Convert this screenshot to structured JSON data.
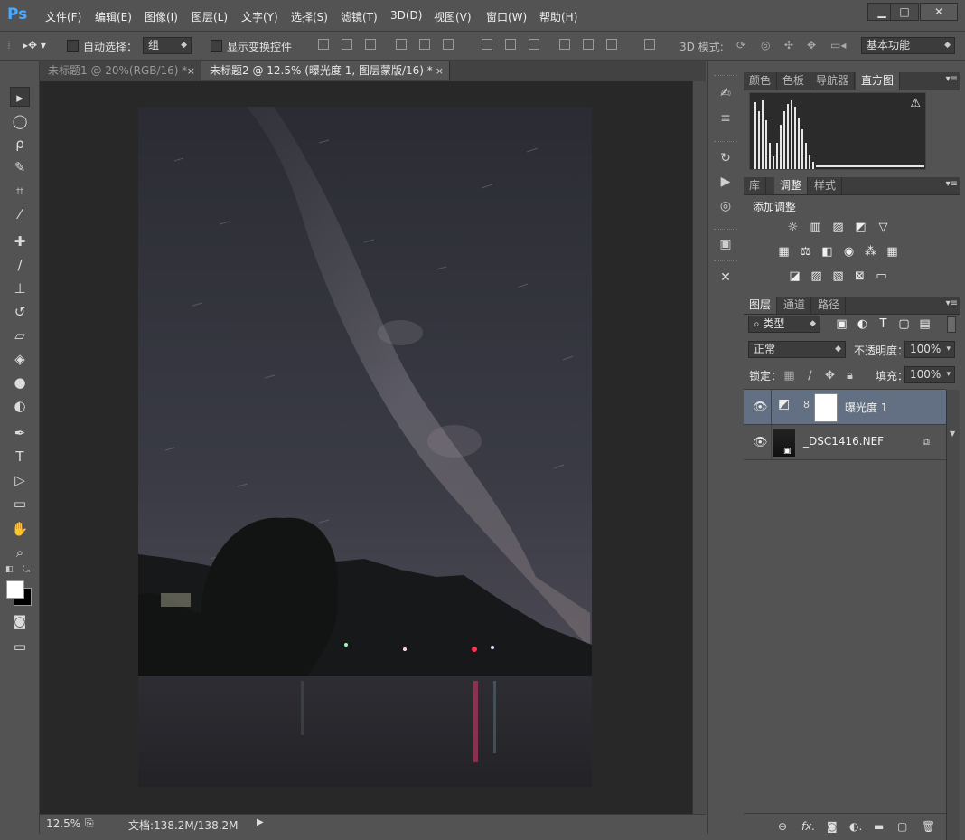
{
  "app": {
    "logo": "Ps"
  },
  "menu": [
    "文件(F)",
    "编辑(E)",
    "图像(I)",
    "图层(L)",
    "文字(Y)",
    "选择(S)",
    "滤镜(T)",
    "3D(D)",
    "视图(V)",
    "窗口(W)",
    "帮助(H)"
  ],
  "window_controls": {
    "minimize": "▁",
    "maximize": "□",
    "close": "✕"
  },
  "options": {
    "auto_select_label": "自动选择：",
    "auto_select_value": "组",
    "show_transform_label": "显示变换控件",
    "mode3d_label": "3D 模式:",
    "workspace_value": "基本功能"
  },
  "tabs": [
    {
      "title": "未标题1 @ 20%(RGB/16) *",
      "close": "×"
    },
    {
      "title": "未标题2 @ 12.5% (曝光度 1, 图层蒙版/16) *",
      "close": "×"
    }
  ],
  "status": {
    "zoom": "12.5%",
    "doc": "文档:138.2M/138.2M",
    "arrow": "▶"
  },
  "panels": {
    "top_tabs": [
      "颜色",
      "色板",
      "导航器",
      "直方图"
    ],
    "top_active": 3,
    "histogram_warning": "⚠",
    "mid_tabs": [
      "库",
      "调整",
      "样式"
    ],
    "mid_active": 1,
    "add_adjustment": "添加调整",
    "layers_tabs": [
      "图层",
      "通道",
      "路径"
    ],
    "layers_active": 0,
    "filter_kind": "类型",
    "blend_mode": "正常",
    "opacity_label": "不透明度：",
    "opacity_value": "100%",
    "lock_label": "锁定：",
    "fill_label": "填充：",
    "fill_value": "100%",
    "menu_glyph": "▾≡"
  },
  "layers": [
    {
      "name": "曝光度 1",
      "selected": true
    },
    {
      "name": "_DSC1416.NEF",
      "selected": false
    }
  ],
  "colors": {
    "ui_bg": "#535353",
    "canvas_bg": "#282828",
    "selected_layer": "#637083",
    "logo": "#4aa8ff"
  }
}
